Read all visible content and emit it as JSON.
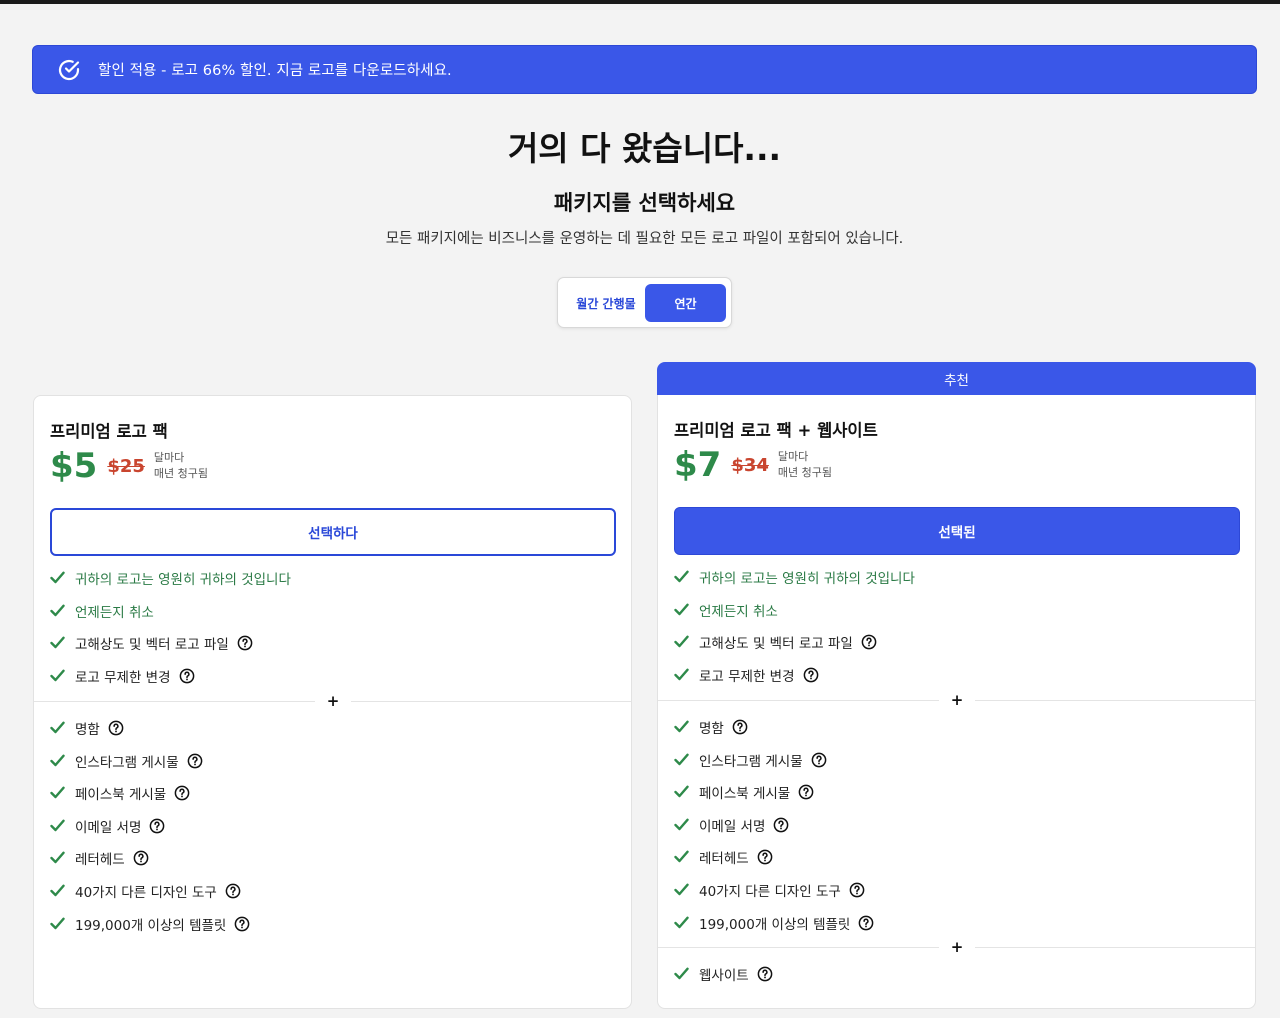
{
  "banner": {
    "icon": "check-circle-icon",
    "text": "할인 적용 - 로고 66% 할인. 지금 로고를 다운로드하세요."
  },
  "header": {
    "title": "거의 다 왔습니다...",
    "subtitle": "패키지를 선택하세요",
    "description": "모든 패키지에는 비즈니스를 운영하는 데 필요한 모든 로고 파일이 포함되어 있습니다."
  },
  "billing_toggle": {
    "monthly_label": "월간 간행물",
    "yearly_label": "연간",
    "selected": "연간"
  },
  "colors": {
    "accent": "#3a57e8",
    "price_green": "#2e8a4a",
    "old_price_red": "#c9452f"
  },
  "plans": [
    {
      "name": "프리미엄 로고 팩",
      "price": "$5",
      "old_price": "$25",
      "per": "달마다",
      "billing": "매년 청구됨",
      "button_label": "선택하다",
      "selected": false,
      "core_features": [
        {
          "label": "귀하의 로고는 영원히 귀하의 것입니다",
          "help": false
        },
        {
          "label": "언제든지 취소",
          "help": false
        },
        {
          "label": "고해상도 및 벡터 로고 파일",
          "help": true
        },
        {
          "label": "로고 무제한 변경",
          "help": true
        }
      ],
      "plus": "+",
      "extra_features": [
        {
          "label": "명함",
          "help": true
        },
        {
          "label": "인스타그램 게시물",
          "help": true
        },
        {
          "label": "페이스북 게시물",
          "help": true
        },
        {
          "label": "이메일 서명",
          "help": true
        },
        {
          "label": "레터헤드",
          "help": true
        },
        {
          "label": "40가지 다른 디자인 도구",
          "help": true
        },
        {
          "label": "199,000개 이상의 템플릿",
          "help": true
        }
      ]
    },
    {
      "recommended_label": "추천",
      "name": "프리미엄 로고 팩 + 웹사이트",
      "price": "$7",
      "old_price": "$34",
      "per": "달마다",
      "billing": "매년 청구됨",
      "button_label": "선택된",
      "selected": true,
      "core_features": [
        {
          "label": "귀하의 로고는 영원히 귀하의 것입니다",
          "help": false
        },
        {
          "label": "언제든지 취소",
          "help": false
        },
        {
          "label": "고해상도 및 벡터 로고 파일",
          "help": true
        },
        {
          "label": "로고 무제한 변경",
          "help": true
        }
      ],
      "plus": "+",
      "extra_features": [
        {
          "label": "명함",
          "help": true
        },
        {
          "label": "인스타그램 게시물",
          "help": true
        },
        {
          "label": "페이스북 게시물",
          "help": true
        },
        {
          "label": "이메일 서명",
          "help": true
        },
        {
          "label": "레터헤드",
          "help": true
        },
        {
          "label": "40가지 다른 디자인 도구",
          "help": true
        },
        {
          "label": "199,000개 이상의 템플릿",
          "help": true
        }
      ],
      "plus2": "+",
      "website_features": [
        {
          "label": "웹사이트",
          "help": true
        }
      ]
    }
  ]
}
